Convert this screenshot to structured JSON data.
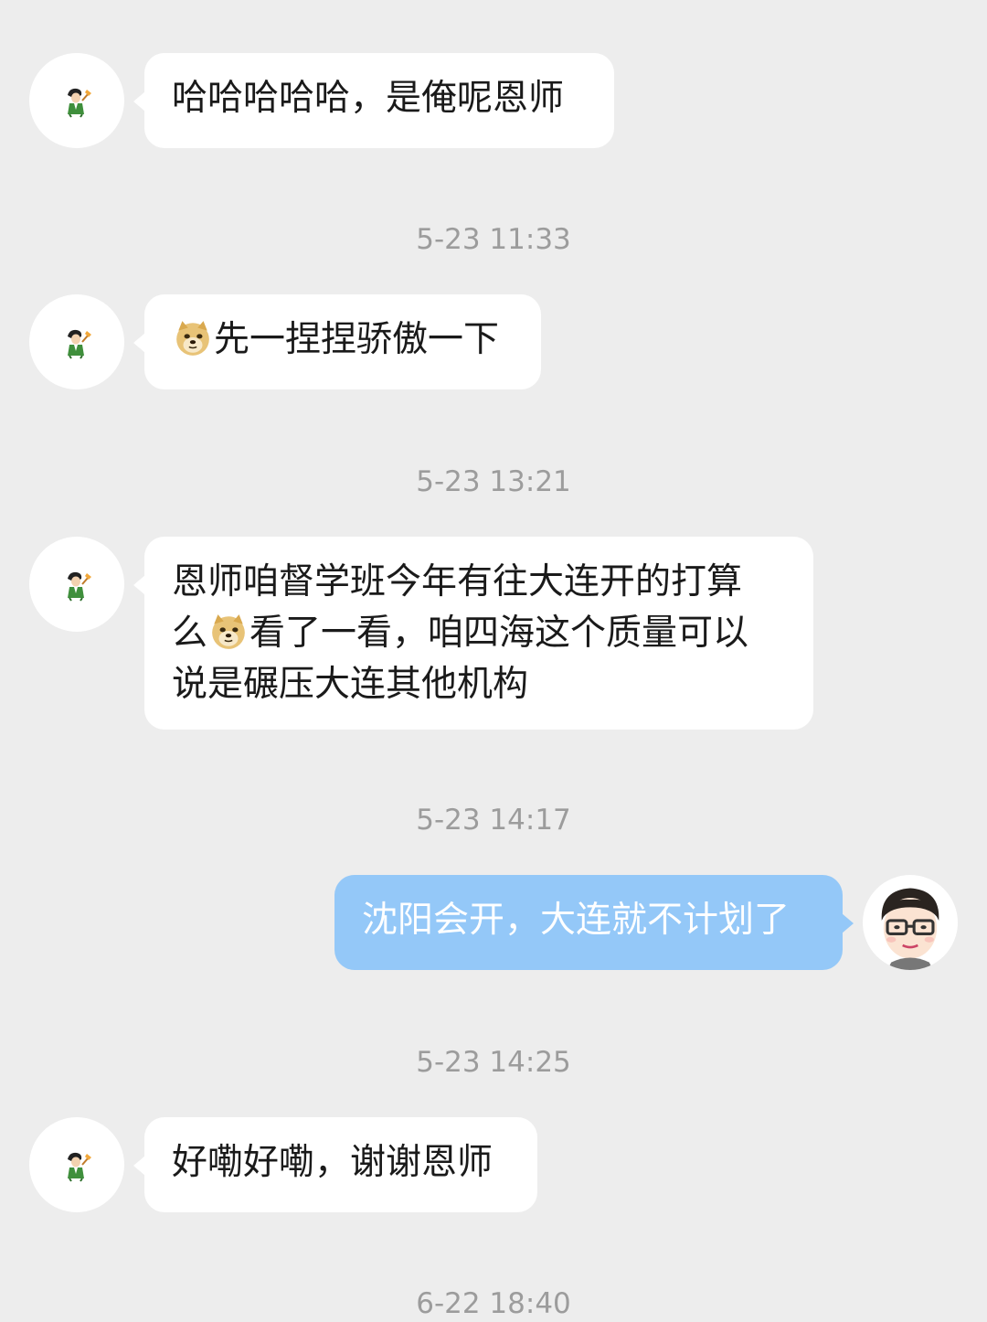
{
  "messages": [
    {
      "sender": "other",
      "text": "哈哈哈哈哈，是俺呢恩师"
    },
    {
      "timestamp": "5-23 11:33"
    },
    {
      "sender": "other",
      "emoji": "doge",
      "text": "先一捏捏骄傲一下"
    },
    {
      "timestamp": "5-23 13:21"
    },
    {
      "sender": "other",
      "lines": [
        "恩师咱督学班今年有往大连开的打算",
        "看了一看，咱四海这个质量可以",
        "说是碾压大连其他机构"
      ],
      "line2_prefix": "么",
      "emoji": "doge"
    },
    {
      "timestamp": "5-23 14:17"
    },
    {
      "sender": "me",
      "text": "沈阳会开，大连就不计划了"
    },
    {
      "timestamp": "5-23 14:25"
    },
    {
      "sender": "other",
      "text": "好嘞好嘞，谢谢恩师"
    },
    {
      "timestamp": "6-22 18:40"
    }
  ],
  "colors": {
    "background": "#ededed",
    "bubble_in": "#ffffff",
    "bubble_out": "#94c8f8",
    "timestamp": "#9c9c9c"
  },
  "icons": {
    "other_avatar": "cartoon-person-avatar-icon",
    "my_avatar": "man-with-glasses-avatar-icon",
    "emoji": "doge-emoji-icon"
  }
}
